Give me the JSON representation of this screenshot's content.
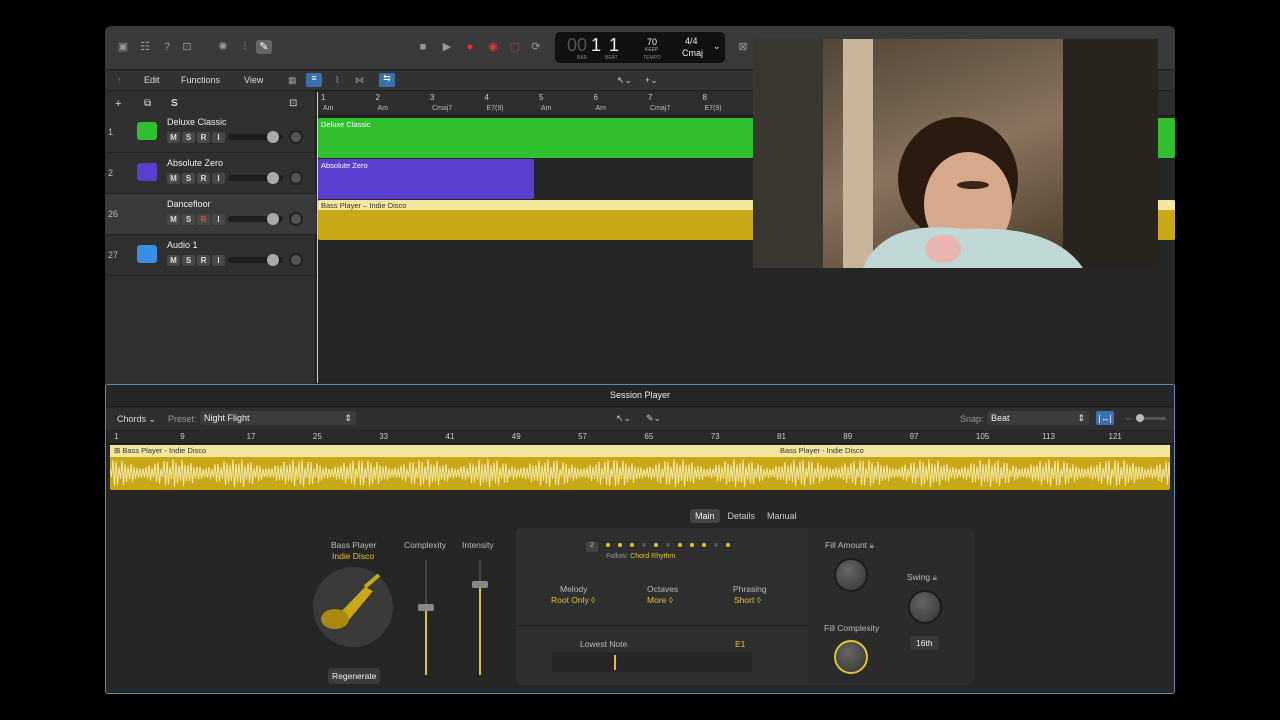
{
  "toolbar": {
    "icons": [
      "library-icon",
      "inspector-icon",
      "help-icon",
      "browser-icon",
      "smart-controls-icon",
      "mixer-icon",
      "editors-icon"
    ],
    "lcd": {
      "bar": "1",
      "beat": "1",
      "bar_label": "BAR",
      "beat_label": "BEAT",
      "tempo": "70",
      "tempo_mode": "KEEP",
      "tempo_label": "TEMPO",
      "sig": "4/4",
      "key": "Cmaj"
    }
  },
  "menubar": {
    "back": "↑",
    "edit": "Edit",
    "functions": "Functions",
    "view": "View"
  },
  "trackheader": {
    "add": "+",
    "dup": "⧉",
    "s": "S"
  },
  "ruler": [
    "1",
    "2",
    "3",
    "4",
    "5",
    "6",
    "7",
    "8"
  ],
  "chords": [
    "Am",
    "Am",
    "Cmaj7",
    "E7(9)",
    "Am",
    "Am",
    "Cmaj7",
    "E7(9)"
  ],
  "tracks": [
    {
      "num": "1",
      "name": "Deluxe Classic",
      "color": "#2fbf2f",
      "icon": "piano-icon"
    },
    {
      "num": "2",
      "name": "Absolute Zero",
      "color": "#5b3fd0",
      "icon": "synth-icon"
    },
    {
      "num": "26",
      "name": "Dancefloor",
      "color": "#c9a818",
      "icon": "guitar-icon"
    },
    {
      "num": "27",
      "name": "Audio 1",
      "color": "#3a8ee6",
      "icon": "waveform-icon"
    }
  ],
  "mute": "M",
  "solo": "S",
  "rec": "R",
  "input": "I",
  "regions": {
    "r1": "Deluxe Classic",
    "r2": "Absolute Zero",
    "r3": "Bass Player – Indie Disco"
  },
  "session": {
    "title": "Session Player",
    "mode": "Chords",
    "preset_label": "Preset:",
    "preset": "Night Flight",
    "snap_label": "Snap:",
    "snap": "Beat",
    "ruler": [
      "1",
      "9",
      "17",
      "25",
      "33",
      "41",
      "49",
      "57",
      "65",
      "73",
      "81",
      "89",
      "97",
      "105",
      "113",
      "121"
    ],
    "region_a": "Bass Player - Indie Disco",
    "region_b": "Bass Player - Indie Disco",
    "tabs": [
      "Main",
      "Details",
      "Manual"
    ],
    "player_label": "Bass Player",
    "player_style": "Indie Disco",
    "complexity": "Complexity",
    "intensity": "Intensity",
    "regenerate": "Regenerate",
    "follow_num": "2",
    "follow_label": "Follow:",
    "follow_value": "Chord Rhythm",
    "melody_label": "Melody",
    "melody": "Root Only ◊",
    "octaves_label": "Octaves",
    "octaves": "More ◊",
    "phrasing_label": "Phrasing",
    "phrasing": "Short ◊",
    "lowest_label": "Lowest Note",
    "lowest": "E1",
    "fill_amount": "Fill Amount",
    "fill_complexity": "Fill Complexity",
    "swing": "Swing",
    "swing_value": "16th"
  }
}
